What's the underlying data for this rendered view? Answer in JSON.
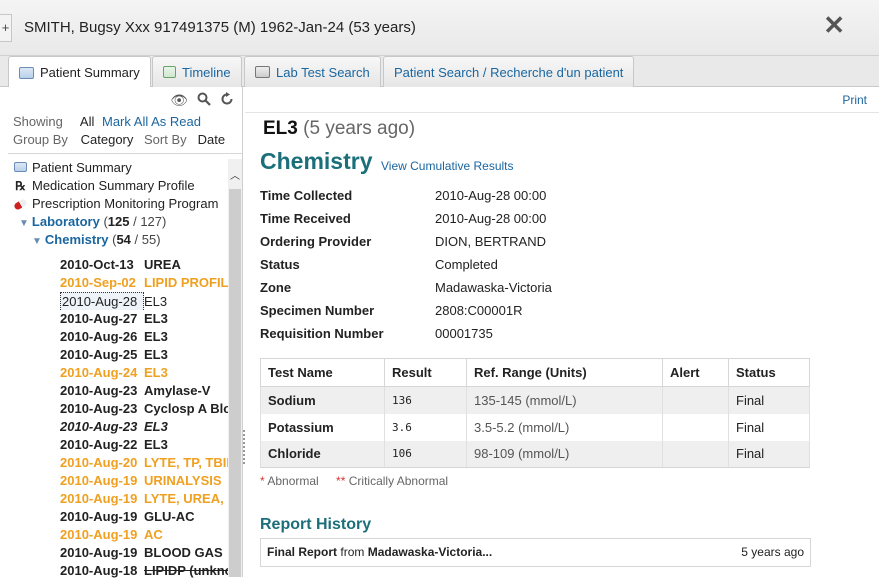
{
  "header": {
    "add_tab": "+",
    "patient": "SMITH, Bugsy Xxx 917491375 (M) 1962-Jan-24 (53 years)",
    "close": "✕"
  },
  "tabs": [
    {
      "label": "Patient Summary",
      "icon": "patient-summary-icon",
      "active": true
    },
    {
      "label": "Timeline",
      "icon": "timeline-icon",
      "active": false
    },
    {
      "label": "Lab Test Search",
      "icon": "lab-test-search-icon",
      "active": false
    },
    {
      "label": "Patient Search / Recherche d'un patient",
      "active": false
    }
  ],
  "left": {
    "icons": [
      "eye-icon",
      "search-icon",
      "refresh-icon"
    ],
    "showing_label": "Showing",
    "showing_value": "All",
    "mark_all_read": "Mark All As Read",
    "group_by_label": "Group By",
    "group_by_value": "Category",
    "sort_by_label": "Sort By",
    "sort_by_value": "Date",
    "tree": {
      "patient_summary": "Patient Summary",
      "medication_profile": "Medication Summary Profile",
      "prescription_monitoring": "Prescription Monitoring Program",
      "laboratory": "Laboratory",
      "laboratory_count_a": "125",
      "laboratory_count_b": "127",
      "chemistry": "Chemistry",
      "chemistry_count_a": "54",
      "chemistry_count_b": "55"
    },
    "results": [
      {
        "date": "2010-Oct-13",
        "name": "UREA",
        "style": "normal"
      },
      {
        "date": "2010-Sep-02",
        "name": "LIPID PROFILE",
        "style": "orange"
      },
      {
        "date": "2010-Aug-28",
        "name": "EL3",
        "style": "selected"
      },
      {
        "date": "2010-Aug-27",
        "name": "EL3",
        "style": "normal"
      },
      {
        "date": "2010-Aug-26",
        "name": "EL3",
        "style": "normal"
      },
      {
        "date": "2010-Aug-25",
        "name": "EL3",
        "style": "normal"
      },
      {
        "date": "2010-Aug-24",
        "name": "EL3",
        "style": "orange"
      },
      {
        "date": "2010-Aug-23",
        "name": "Amylase-V",
        "style": "normal"
      },
      {
        "date": "2010-Aug-23",
        "name": "Cyclosp A Blood",
        "style": "normal"
      },
      {
        "date": "2010-Aug-23",
        "name": "EL3",
        "style": "italic"
      },
      {
        "date": "2010-Aug-22",
        "name": "EL3",
        "style": "normal"
      },
      {
        "date": "2010-Aug-20",
        "name": "LYTE, TP, TBIL",
        "style": "orange"
      },
      {
        "date": "2010-Aug-19",
        "name": "URINALYSIS",
        "style": "orange"
      },
      {
        "date": "2010-Aug-19",
        "name": "LYTE, UREA, CR",
        "style": "orange"
      },
      {
        "date": "2010-Aug-19",
        "name": "GLU-AC",
        "style": "normal"
      },
      {
        "date": "2010-Aug-19",
        "name": "AC",
        "style": "orange"
      },
      {
        "date": "2010-Aug-19",
        "name": "BLOOD GAS",
        "style": "normal"
      },
      {
        "date": "2010-Aug-18",
        "name": "LIPIDP (unknown)",
        "style": "strike"
      }
    ]
  },
  "main": {
    "print": "Print",
    "title": "EL3",
    "title_sub": "(5 years ago)",
    "section": "Chemistry",
    "cumulative_link": "View Cumulative Results",
    "details": [
      {
        "label": "Time Collected",
        "value": "2010-Aug-28 00:00"
      },
      {
        "label": "Time Received",
        "value": "2010-Aug-28 00:00"
      },
      {
        "label": "Ordering Provider",
        "value": "DION, BERTRAND"
      },
      {
        "label": "Status",
        "value": "Completed"
      },
      {
        "label": "Zone",
        "value": "Madawaska-Victoria"
      },
      {
        "label": "Specimen Number",
        "value": "2808:C00001R"
      },
      {
        "label": "Requisition Number",
        "value": "00001735"
      }
    ],
    "table": {
      "headers": [
        "Test Name",
        "Result",
        "Ref. Range (Units)",
        "Alert",
        "Status"
      ],
      "rows": [
        [
          "Sodium",
          "136",
          "135-145 (mmol/L)",
          "",
          "Final"
        ],
        [
          "Potassium",
          "3.6",
          "3.5-5.2 (mmol/L)",
          "",
          "Final"
        ],
        [
          "Chloride",
          "106",
          "98-109 (mmol/L)",
          "",
          "Final"
        ]
      ]
    },
    "legend_abnormal": "* Abnormal",
    "legend_critical_star": "**",
    "legend_critical": "Critically Abnormal",
    "report_history": "Report History",
    "report": {
      "prefix": "Final Report",
      "from": "from",
      "source": "Madawaska-Victoria...",
      "time": "5 years ago"
    }
  }
}
